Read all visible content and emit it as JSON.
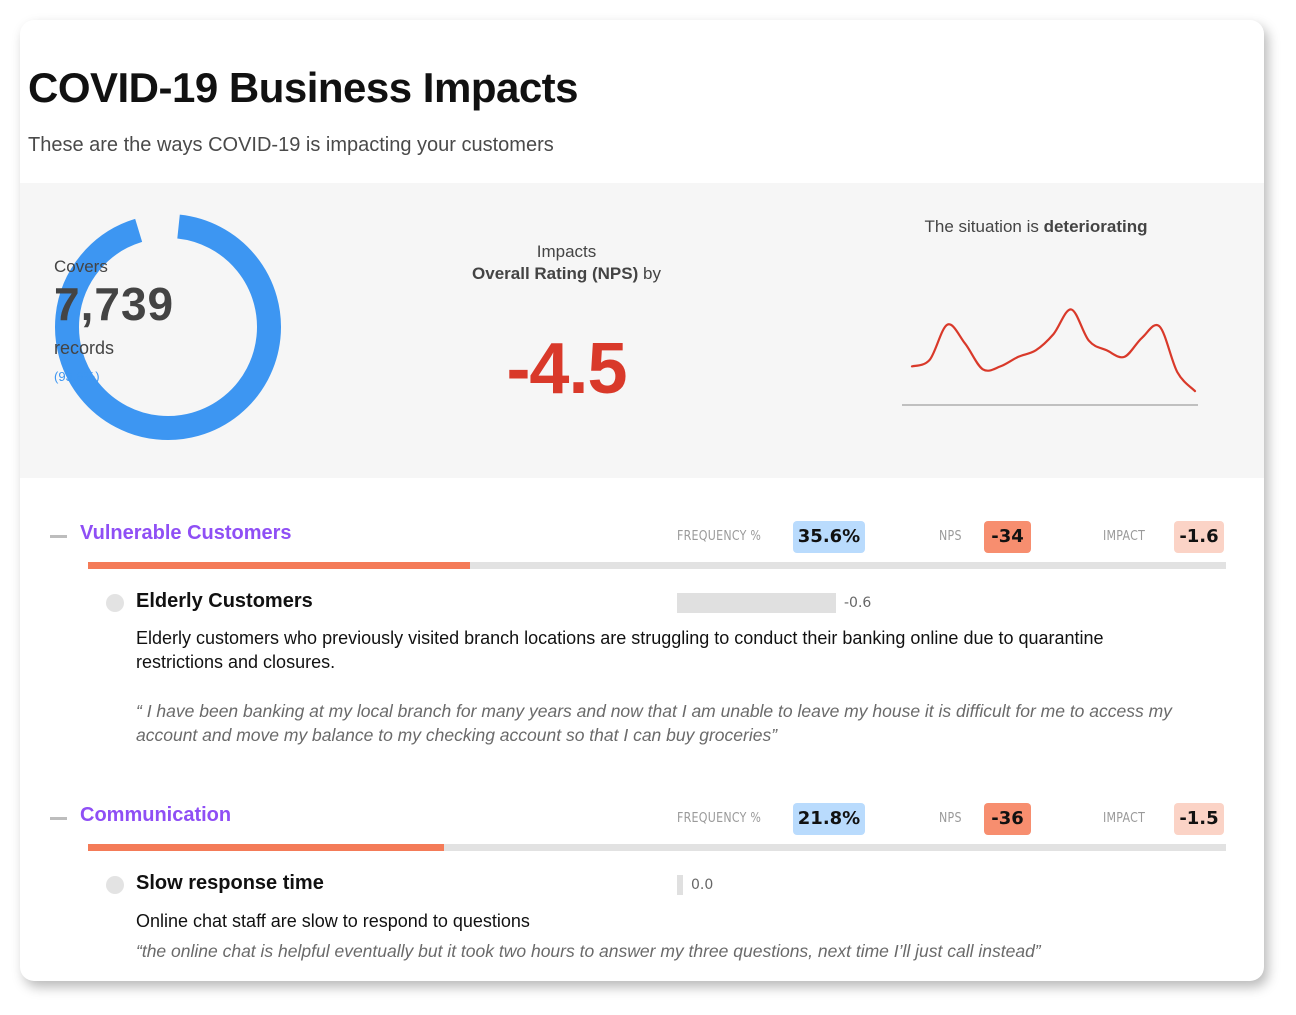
{
  "header": {
    "title": "COVID-19 Business Impacts",
    "subtitle": "These are the ways COVID-19 is impacting your customers"
  },
  "summary": {
    "coverage": {
      "label_top": "Covers",
      "count": "7,739",
      "label_bottom": "records",
      "percent_text": "(93.6%)",
      "percent": 93.6,
      "color": "#3d96f2"
    },
    "impact": {
      "line1": "Impacts",
      "metric": "Overall Rating (NPS)",
      "suffix": " by",
      "value": "-4.5",
      "color": "#d9392a"
    },
    "trend": {
      "prefix": "The situation is ",
      "status": "deteriorating",
      "color": "#d9392a",
      "series": [
        0.18,
        0.25,
        0.62,
        0.42,
        0.15,
        0.18,
        0.28,
        0.35,
        0.52,
        0.78,
        0.45,
        0.35,
        0.28,
        0.48,
        0.6,
        0.12,
        -0.08
      ]
    }
  },
  "metric_labels": {
    "frequency": "FREQUENCY %",
    "nps": "NPS",
    "impact": "IMPACT"
  },
  "sections": [
    {
      "name": "Vulnerable Customers",
      "frequency": "35.6%",
      "nps": "-34",
      "impact": "-1.6",
      "progress": 0.336,
      "items": [
        {
          "title": "Elderly Customers",
          "impact_value": "-0.6",
          "impact_magnitude": 0.6,
          "description": "Elderly customers who previously visited branch locations are struggling to conduct their banking online due to quarantine restrictions and closures.",
          "quote": "“ I have been banking at my local branch for many years and now that I am unable to leave my house it is difficult for me to access my account and move my balance to my checking account so that I can buy groceries”"
        }
      ]
    },
    {
      "name": "Communication",
      "frequency": "21.8%",
      "nps": "-36",
      "impact": "-1.5",
      "progress": 0.313,
      "items": [
        {
          "title": "Slow response time",
          "impact_value": "0.0",
          "impact_magnitude": 0.0,
          "description": "Online chat staff are slow to respond to questions",
          "quote": "“the online chat is helpful eventually but it took two hours to answer my three questions, next time I’ll just call instead”"
        }
      ]
    }
  ]
}
